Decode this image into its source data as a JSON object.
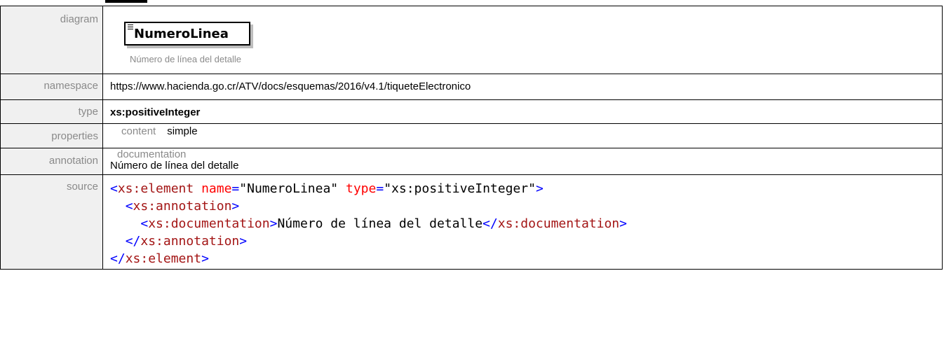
{
  "rows": {
    "diagram": {
      "label": "diagram",
      "element_name": "NumeroLinea",
      "element_doc": "Número de línea del detalle"
    },
    "namespace": {
      "label": "namespace",
      "value": "https://www.hacienda.go.cr/ATV/docs/esquemas/2016/v4.1/tiqueteElectronico"
    },
    "type": {
      "label": "type",
      "value": "xs:positiveInteger"
    },
    "properties": {
      "label": "properties",
      "key": "content",
      "value": "simple"
    },
    "annotation": {
      "label": "annotation",
      "key": "documentation",
      "value": "Número de línea del detalle"
    },
    "source": {
      "label": "source",
      "lines": {
        "l1": {
          "open": "<",
          "tag": "xs:element",
          "a1": "name",
          "eq1": "=",
          "v1": "\"NumeroLinea\"",
          "a2": "type",
          "eq2": "=",
          "v2": "\"xs:positiveInteger\"",
          "close": ">"
        },
        "l2": {
          "indent": "  ",
          "open": "<",
          "tag": "xs:annotation",
          "close": ">"
        },
        "l3": {
          "indent": "    ",
          "open": "<",
          "tag": "xs:documentation",
          "close": ">",
          "text": "Número de línea del detalle",
          "open2": "</",
          "tag2": "xs:documentation",
          "close2": ">"
        },
        "l4": {
          "indent": "  ",
          "open": "</",
          "tag": "xs:annotation",
          "close": ">"
        },
        "l5": {
          "indent": "",
          "open": "</",
          "tag": "xs:element",
          "close": ">"
        }
      }
    }
  },
  "colors": {
    "label_bg": "#f0f0f0",
    "label_text": "#8a8a8a",
    "xml_tag": "#a31515",
    "xml_bracket": "#0000ff",
    "xml_attr": "#ff0000",
    "xml_value": "#0000ff"
  },
  "icons": {
    "element_icon": "element-lines-icon"
  }
}
